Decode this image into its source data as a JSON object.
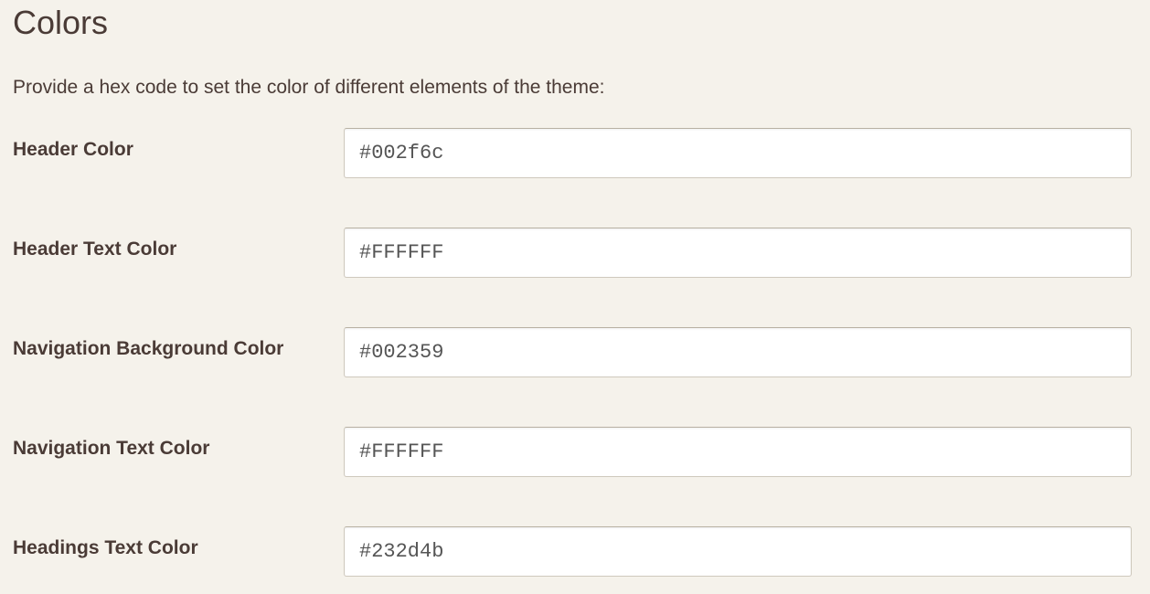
{
  "section": {
    "title": "Colors",
    "description": "Provide a hex code to set the color of different elements of the theme:"
  },
  "fields": {
    "header_color": {
      "label": "Header Color",
      "value": "#002f6c"
    },
    "header_text_color": {
      "label": "Header Text Color",
      "value": "#FFFFFF"
    },
    "navigation_background_color": {
      "label": "Navigation Background Color",
      "value": "#002359"
    },
    "navigation_text_color": {
      "label": "Navigation Text Color",
      "value": "#FFFFFF"
    },
    "headings_text_color": {
      "label": "Headings Text Color",
      "value": "#232d4b"
    }
  }
}
